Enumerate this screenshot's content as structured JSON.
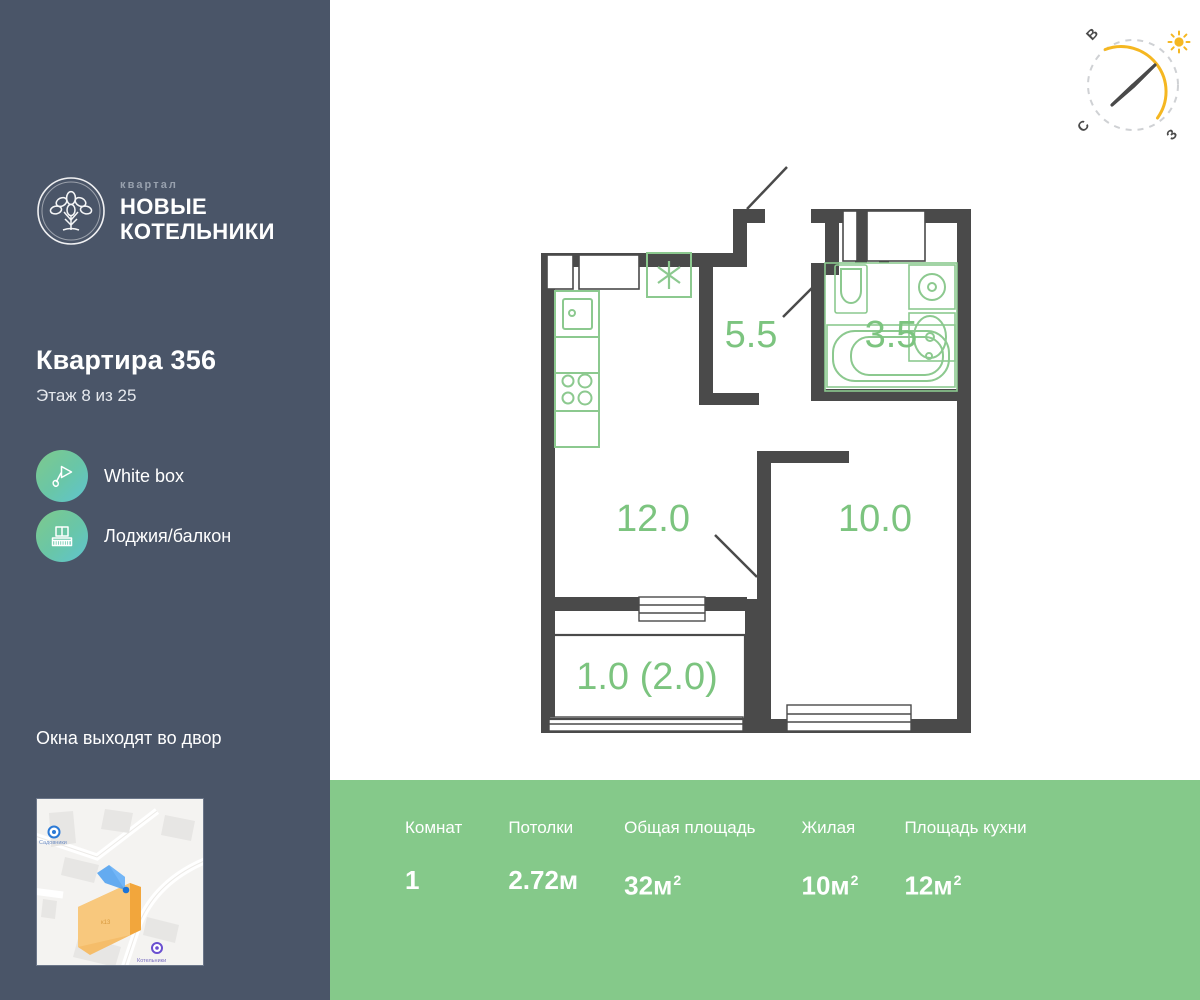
{
  "sidebar": {
    "logo": {
      "eyebrow": "квартал",
      "line1": "НОВЫЕ",
      "line2": "КОТЕЛЬНИКИ",
      "icon": "tree-in-circle-logo"
    },
    "flat_title": "Квартира 356",
    "floor_text": "Этаж 8 из 25",
    "legend": [
      {
        "icon": "paint-trowel-icon",
        "label": "White box"
      },
      {
        "icon": "balcony-icon",
        "label": "Лоджия/балкон"
      }
    ],
    "yard_text": "Окна выходят во двор",
    "map": {
      "icon": "map-thumbnail",
      "building_label": "к13",
      "poi_left": "Садовники",
      "poi_bottom": "Котельники"
    }
  },
  "compass": {
    "icon": "compass-rose-icon",
    "sun_icon": "sun-icon",
    "letters": [
      "В",
      "С",
      "З"
    ],
    "arc_color": "#f5b721",
    "needle_color": "#4a4a4a"
  },
  "plan": {
    "icon": "floor-plan",
    "wall_color": "#4a4a4a",
    "fixture_color": "#8cc98f",
    "label_color": "#7cc47f",
    "rooms": [
      {
        "name": "hall",
        "area": "5.5"
      },
      {
        "name": "bathroom",
        "area": "3.5"
      },
      {
        "name": "kitchen-living",
        "area": "12.0"
      },
      {
        "name": "bedroom",
        "area": "10.0"
      },
      {
        "name": "balcony",
        "area": "1.0 (2.0)"
      }
    ],
    "fixtures": [
      "sink-icon",
      "stove-icon",
      "fridge-icon",
      "toilet-icon",
      "washer-icon",
      "basin-icon",
      "bathtub-icon"
    ]
  },
  "stats": {
    "items": [
      {
        "label": "Комнат",
        "value": "1",
        "unit": "",
        "sup": ""
      },
      {
        "label": "Потолки",
        "value": "2.72",
        "unit": "м",
        "sup": ""
      },
      {
        "label": "Общая площадь",
        "value": "32",
        "unit": "м",
        "sup": "2"
      },
      {
        "label": "Жилая",
        "value": "10",
        "unit": "м",
        "sup": "2"
      },
      {
        "label": "Площадь кухни",
        "value": "12",
        "unit": "м",
        "sup": "2"
      }
    ]
  },
  "colors": {
    "sidebar_bg": "#4a5568",
    "stats_bg": "#85c98a",
    "plan_green": "#7cc47f",
    "plan_wall": "#4a4a4a",
    "accent_yellow": "#f5b721"
  }
}
